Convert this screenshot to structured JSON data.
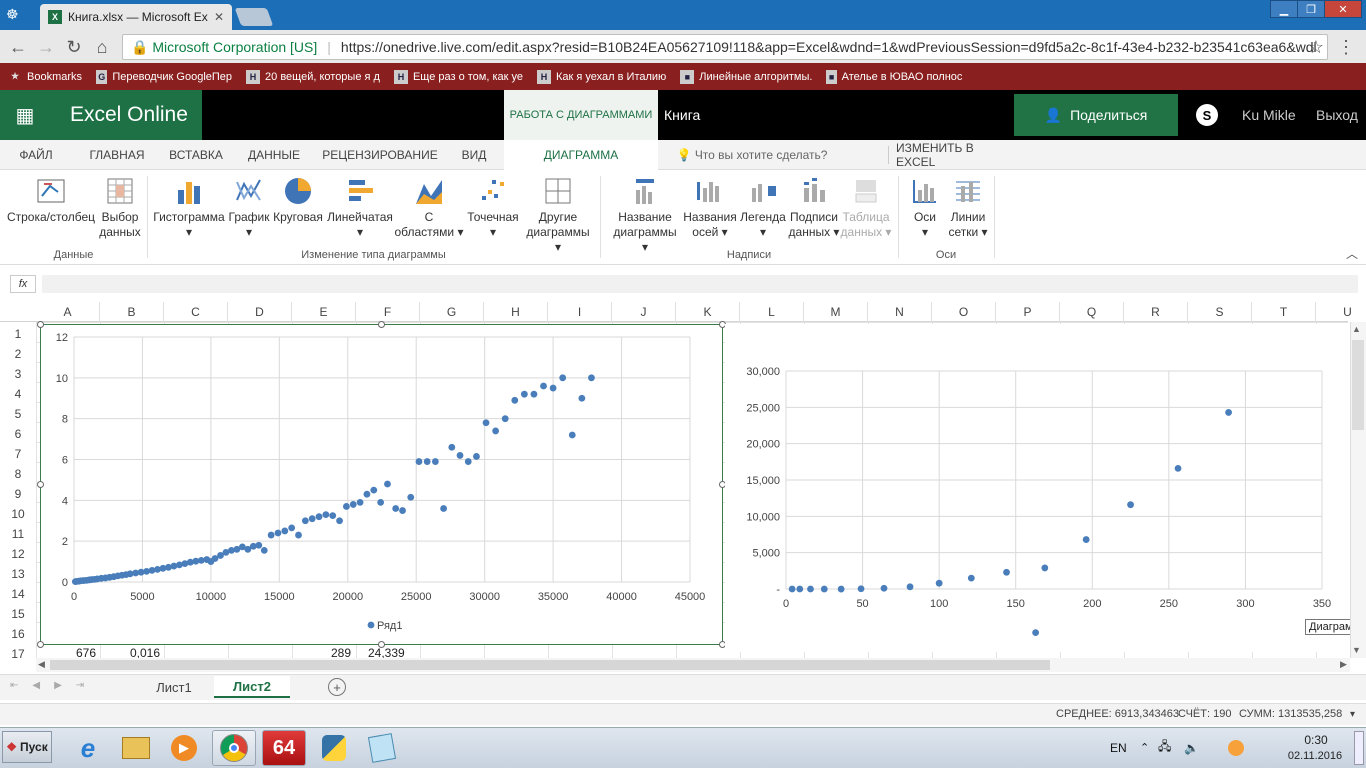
{
  "browser": {
    "tab_title": "Книга.xlsx — Microsoft Exc",
    "tab_icon": "X",
    "security_label": "Microsoft Corporation [US]",
    "url": "https://onedrive.live.com/edit.aspx?resid=B10B24EA05627109!118&app=Excel&wdnd=1&wdPreviousSession=d9fd5a2c-8c1f-43e4-b232-b23541c63ea6&wdl",
    "bookmarks": [
      {
        "label": "Bookmarks",
        "icon": "★"
      },
      {
        "label": "Переводчик GoogleПер",
        "icon": "G"
      },
      {
        "label": "20 вещей, которые я д",
        "icon": "H"
      },
      {
        "label": "Еще раз о том, как уе",
        "icon": "H"
      },
      {
        "label": "Как я уехал в Италию",
        "icon": "H"
      },
      {
        "label": "Линейные алгоритмы.",
        "icon": "■"
      },
      {
        "label": "Ателье в ЮВАО полнос",
        "icon": "■"
      }
    ]
  },
  "excel": {
    "brand": "Excel Online",
    "context_tab": "РАБОТА С ДИАГРАММАМИ",
    "book_name": "Книга",
    "share_label": "Поделиться",
    "user_name": "Ku Mikle",
    "logout_label": "Выход",
    "menu": [
      "ФАЙЛ",
      "ГЛАВНАЯ",
      "ВСТАВКА",
      "ДАННЫЕ",
      "РЕЦЕНЗИРОВАНИЕ",
      "ВИД",
      "ДИАГРАММА"
    ],
    "tell_me": "Что вы хотите сделать?",
    "edit_in_excel": "ИЗМЕНИТЬ В EXCEL"
  },
  "ribbon": {
    "buttons": [
      {
        "l1": "Строка/столбец",
        "l2": ""
      },
      {
        "l1": "Выбор",
        "l2": "данных"
      },
      {
        "l1": "Гистограмма",
        "l2": "▾"
      },
      {
        "l1": "График",
        "l2": "▾"
      },
      {
        "l1": "Круговая",
        "l2": "▾"
      },
      {
        "l1": "Линейчатая",
        "l2": "▾"
      },
      {
        "l1": "С",
        "l2": "областями ▾"
      },
      {
        "l1": "Точечная",
        "l2": "▾"
      },
      {
        "l1": "Другие",
        "l2": "диаграммы ▾"
      },
      {
        "l1": "Название",
        "l2": "диаграммы ▾"
      },
      {
        "l1": "Названия",
        "l2": "осей ▾"
      },
      {
        "l1": "Легенда",
        "l2": "▾"
      },
      {
        "l1": "Подписи",
        "l2": "данных ▾"
      },
      {
        "l1": "Таблица",
        "l2": "данных ▾"
      },
      {
        "l1": "Оси",
        "l2": "▾"
      },
      {
        "l1": "Линии",
        "l2": "сетки ▾"
      }
    ],
    "groups": [
      "Данные",
      "Изменение типа диаграммы",
      "Надписи",
      "Оси"
    ]
  },
  "formula": {
    "fx": "fx"
  },
  "grid": {
    "columns": [
      "A",
      "B",
      "C",
      "D",
      "E",
      "F",
      "G",
      "H",
      "I",
      "J",
      "K",
      "L",
      "M",
      "N",
      "O",
      "P",
      "Q",
      "R",
      "S",
      "T",
      "U"
    ],
    "rows": [
      "1",
      "2",
      "3",
      "4",
      "5",
      "6",
      "7",
      "8",
      "9",
      "10",
      "11",
      "12",
      "13",
      "14",
      "15",
      "16",
      "17"
    ],
    "row17": {
      "A": "676",
      "B": "0,016",
      "E": "289",
      "F": "24,339"
    }
  },
  "chart_data": [
    {
      "type": "scatter",
      "title": "",
      "xlim": [
        0,
        45000
      ],
      "ylim": [
        0,
        12
      ],
      "x_ticks": [
        "0",
        "5000",
        "10000",
        "15000",
        "20000",
        "25000",
        "30000",
        "35000",
        "40000",
        "45000"
      ],
      "y_ticks": [
        "0",
        "2",
        "4",
        "6",
        "8",
        "10",
        "12"
      ],
      "legend": "bottom",
      "grid": true,
      "series": [
        {
          "name": "Ряд1",
          "color": "#4a7ebb",
          "points": [
            [
              100,
              0.02
            ],
            [
              200,
              0.03
            ],
            [
              350,
              0.04
            ],
            [
              500,
              0.06
            ],
            [
              700,
              0.07
            ],
            [
              900,
              0.08
            ],
            [
              1100,
              0.1
            ],
            [
              1300,
              0.12
            ],
            [
              1500,
              0.13
            ],
            [
              1700,
              0.15
            ],
            [
              2000,
              0.18
            ],
            [
              2300,
              0.2
            ],
            [
              2600,
              0.23
            ],
            [
              2900,
              0.26
            ],
            [
              3200,
              0.3
            ],
            [
              3500,
              0.33
            ],
            [
              3800,
              0.36
            ],
            [
              4100,
              0.4
            ],
            [
              4500,
              0.44
            ],
            [
              4900,
              0.48
            ],
            [
              5300,
              0.52
            ],
            [
              5700,
              0.57
            ],
            [
              6100,
              0.62
            ],
            [
              6500,
              0.67
            ],
            [
              6900,
              0.72
            ],
            [
              7300,
              0.78
            ],
            [
              7700,
              0.84
            ],
            [
              8100,
              0.9
            ],
            [
              8500,
              0.97
            ],
            [
              8900,
              1.02
            ],
            [
              9300,
              1.06
            ],
            [
              9700,
              1.1
            ],
            [
              10000,
              1.0
            ],
            [
              10300,
              1.15
            ],
            [
              10700,
              1.3
            ],
            [
              11100,
              1.45
            ],
            [
              11500,
              1.55
            ],
            [
              11900,
              1.6
            ],
            [
              12300,
              1.72
            ],
            [
              12700,
              1.6
            ],
            [
              13100,
              1.75
            ],
            [
              13500,
              1.8
            ],
            [
              13900,
              1.55
            ],
            [
              14400,
              2.3
            ],
            [
              14900,
              2.4
            ],
            [
              15400,
              2.5
            ],
            [
              15900,
              2.65
            ],
            [
              16400,
              2.3
            ],
            [
              16900,
              3.0
            ],
            [
              17400,
              3.1
            ],
            [
              17900,
              3.2
            ],
            [
              18400,
              3.3
            ],
            [
              18900,
              3.25
            ],
            [
              19400,
              3.0
            ],
            [
              19900,
              3.7
            ],
            [
              20400,
              3.8
            ],
            [
              20900,
              3.9
            ],
            [
              21400,
              4.3
            ],
            [
              21900,
              4.5
            ],
            [
              22400,
              3.9
            ],
            [
              22900,
              4.8
            ],
            [
              23500,
              3.6
            ],
            [
              24000,
              3.5
            ],
            [
              24600,
              4.15
            ],
            [
              25200,
              5.9
            ],
            [
              25800,
              5.9
            ],
            [
              26400,
              5.9
            ],
            [
              27000,
              3.6
            ],
            [
              27600,
              6.6
            ],
            [
              28200,
              6.2
            ],
            [
              28800,
              5.9
            ],
            [
              29400,
              6.15
            ],
            [
              30100,
              7.8
            ],
            [
              30800,
              7.4
            ],
            [
              31500,
              8.0
            ],
            [
              32200,
              8.9
            ],
            [
              32900,
              9.2
            ],
            [
              33600,
              9.2
            ],
            [
              34300,
              9.6
            ],
            [
              35000,
              9.5
            ],
            [
              35700,
              10.0
            ],
            [
              36400,
              7.2
            ],
            [
              37100,
              9.0
            ],
            [
              37800,
              10.0
            ]
          ]
        }
      ]
    },
    {
      "type": "scatter",
      "title": "",
      "xlim": [
        0,
        350
      ],
      "ylim": [
        0,
        30000
      ],
      "x_ticks": [
        "0",
        "50",
        "100",
        "150",
        "200",
        "250",
        "300",
        "350"
      ],
      "y_ticks": [
        "-",
        "5,000",
        "10,000",
        "15,000",
        "20,000",
        "25,000",
        "30,000"
      ],
      "legend": "none",
      "grid": true,
      "series": [
        {
          "color": "#4a7ebb",
          "points": [
            [
              4,
              -2
            ],
            [
              9,
              -3
            ],
            [
              16,
              -4
            ],
            [
              25,
              -5
            ],
            [
              36,
              -7
            ],
            [
              49,
              30
            ],
            [
              64,
              100
            ],
            [
              81,
              300
            ],
            [
              100,
              800
            ],
            [
              121,
              1500
            ],
            [
              144,
              2300
            ],
            [
              169,
              2900
            ],
            [
              196,
              6800
            ],
            [
              225,
              11600
            ],
            [
              256,
              16600
            ],
            [
              289,
              24300
            ],
            [
              163,
              -6000
            ]
          ]
        }
      ]
    }
  ],
  "tooltip": "Диаграмма",
  "sheets": [
    "Лист1",
    "Лист2"
  ],
  "status": {
    "avg": "СРЕДНЕЕ: 6913,343463",
    "count": "СЧЁТ: 190",
    "sum": "СУММ: 1313535,258"
  },
  "taskbar": {
    "start": "Пуск",
    "lang": "EN",
    "time": "0:30",
    "date": "02.11.2016",
    "chrome_badge": "64"
  }
}
